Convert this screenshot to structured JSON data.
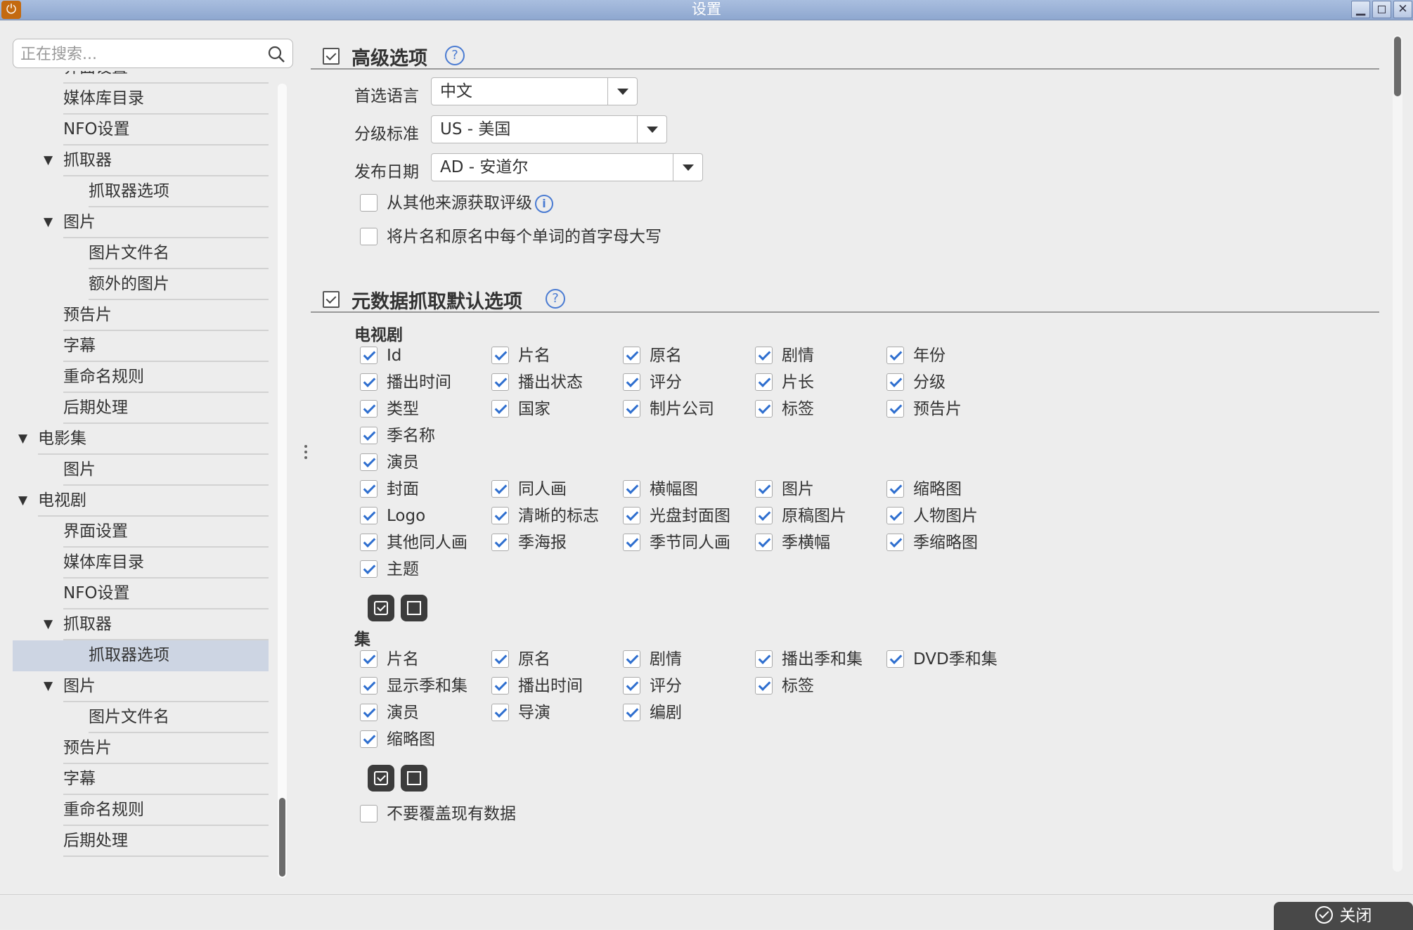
{
  "window": {
    "title": "设置",
    "app_icon": "power-icon",
    "min": "▁",
    "max": "◻",
    "close": "✕"
  },
  "search": {
    "placeholder": "正在搜索..."
  },
  "tree": [
    {
      "label": "界面设置",
      "level": 2
    },
    {
      "label": "媒体库目录",
      "level": 2
    },
    {
      "label": "NFO设置",
      "level": 2
    },
    {
      "label": "抓取器",
      "level": 2,
      "expanded": true
    },
    {
      "label": "抓取器选项",
      "level": 3
    },
    {
      "label": "图片",
      "level": 2,
      "expanded": true
    },
    {
      "label": "图片文件名",
      "level": 3
    },
    {
      "label": "额外的图片",
      "level": 3
    },
    {
      "label": "预告片",
      "level": 2
    },
    {
      "label": "字幕",
      "level": 2
    },
    {
      "label": "重命名规则",
      "level": 2
    },
    {
      "label": "后期处理",
      "level": 2
    },
    {
      "label": "电影集",
      "level": 1,
      "expanded": true
    },
    {
      "label": "图片",
      "level": 2
    },
    {
      "label": "电视剧",
      "level": 1,
      "expanded": true
    },
    {
      "label": "界面设置",
      "level": 2
    },
    {
      "label": "媒体库目录",
      "level": 2
    },
    {
      "label": "NFO设置",
      "level": 2
    },
    {
      "label": "抓取器",
      "level": 2,
      "expanded": true
    },
    {
      "label": "抓取器选项",
      "level": 3,
      "selected": true
    },
    {
      "label": "图片",
      "level": 2,
      "expanded": true
    },
    {
      "label": "图片文件名",
      "level": 3
    },
    {
      "label": "预告片",
      "level": 2
    },
    {
      "label": "字幕",
      "level": 2
    },
    {
      "label": "重命名规则",
      "level": 2
    },
    {
      "label": "后期处理",
      "level": 2
    }
  ],
  "advanced": {
    "title": "高级选项",
    "help": "?",
    "preferred_language_label": "首选语言",
    "preferred_language": "中文",
    "rating_label": "分级标准",
    "rating": "US - 美国",
    "release_label": "发布日期",
    "release": "AD - 安道尔",
    "other_sources": {
      "label": "从其他来源获取评级",
      "checked": false
    },
    "capitalize": {
      "label": "将片名和原名中每个单词的首字母大写",
      "checked": false
    }
  },
  "metadata": {
    "title": "元数据抓取默认选项",
    "help": "?",
    "tv_group": "电视剧",
    "tv_rows": [
      [
        "Id",
        "片名",
        "原名",
        "剧情",
        "年份"
      ],
      [
        "播出时间",
        "播出状态",
        "评分",
        "片长",
        "分级"
      ],
      [
        "类型",
        "国家",
        "制片公司",
        "标签",
        "预告片"
      ],
      [
        "季名称"
      ],
      [
        "演员"
      ],
      [
        "封面",
        "同人画",
        "横幅图",
        "图片",
        "缩略图"
      ],
      [
        "Logo",
        "清晰的标志",
        "光盘封面图",
        "原稿图片",
        "人物图片"
      ],
      [
        "其他同人画",
        "季海报",
        "季节同人画",
        "季横幅",
        "季缩略图"
      ],
      [
        "主题"
      ]
    ],
    "episode_group": "集",
    "episode_rows": [
      [
        "片名",
        "原名",
        "剧情",
        "播出季和集",
        "DVD季和集"
      ],
      [
        "显示季和集",
        "播出时间",
        "评分",
        "标签"
      ],
      [
        "演员",
        "导演",
        "编剧"
      ],
      [
        "缩略图"
      ]
    ],
    "no_overwrite": {
      "label": "不要覆盖现有数据",
      "checked": false
    }
  },
  "footer": {
    "close": "关闭"
  }
}
